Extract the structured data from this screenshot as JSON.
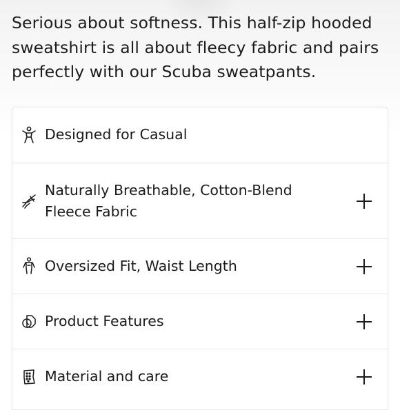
{
  "description": "Serious about softness. This half-zip hooded sweatshirt is all about fleecy fabric and pairs perfectly with our Scuba sweatpants.",
  "features": [
    {
      "icon": "person-icon",
      "label": "Designed for Casual",
      "expandable": false
    },
    {
      "icon": "fabric-twist-icon",
      "label": "Naturally Breathable, Cotton-Blend Fleece Fabric",
      "expandable": true
    },
    {
      "icon": "body-fit-icon",
      "label": "Oversized Fit, Waist Length",
      "expandable": true
    },
    {
      "icon": "product-features-icon",
      "label": "Product Features",
      "expandable": true
    },
    {
      "icon": "care-label-icon",
      "label": "Material and care",
      "expandable": true
    }
  ]
}
